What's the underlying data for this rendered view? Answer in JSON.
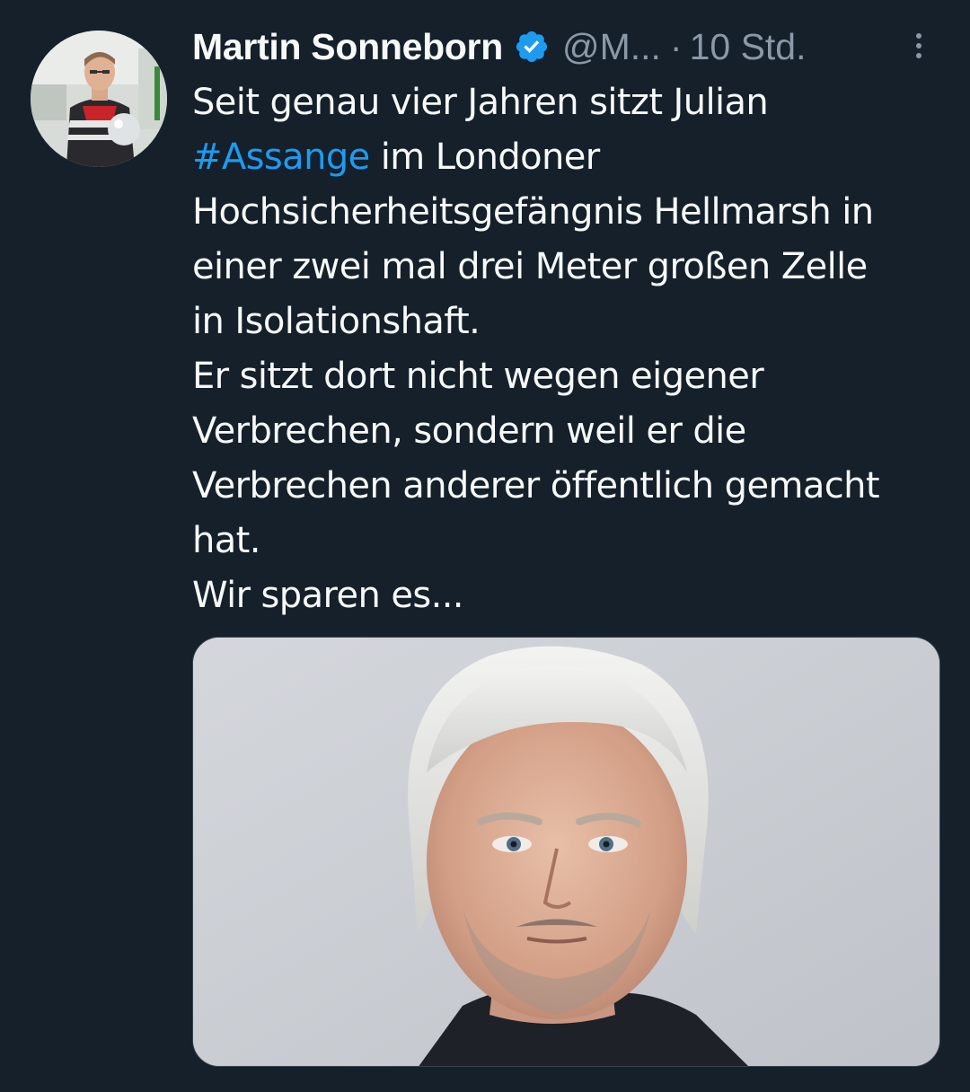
{
  "tweet": {
    "display_name": "Martin Sonneborn",
    "verified_icon": "verified-badge-icon",
    "handle": "@M...",
    "separator": "·",
    "time": "10 Std.",
    "more_icon": "more-vertical-icon",
    "text_lines": [
      "Seit genau vier Jahren sitzt Julian",
      "im Londoner",
      "Hochsicherheitsgefängnis Hellmarsh in",
      "einer zwei mal drei Meter großen Zelle",
      "in Isolationshaft.",
      "Er sitzt dort nicht wegen eigener",
      "Verbrechen, sondern weil er die",
      "Verbrechen anderer öffentlich gemacht",
      "hat.",
      "Wir sparen es..."
    ],
    "hashtag": "#Assange",
    "media_description_icon": "portrait-photo"
  },
  "colors": {
    "background": "#15202b",
    "text": "#f7f9f9",
    "secondary": "#8b98a5",
    "accent": "#1d9bf0"
  }
}
